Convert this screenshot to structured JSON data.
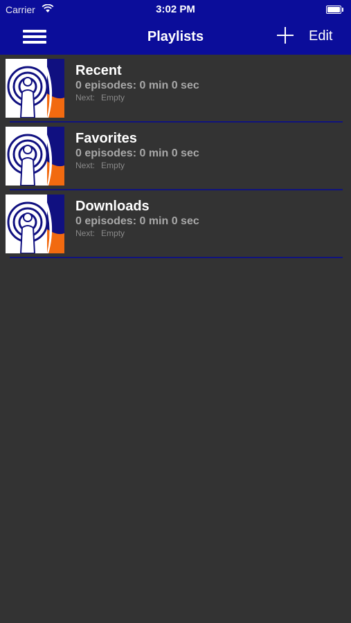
{
  "status_bar": {
    "carrier": "Carrier",
    "time": "3:02 PM"
  },
  "nav": {
    "title": "Playlists",
    "edit_label": "Edit"
  },
  "playlists": [
    {
      "title": "Recent",
      "summary": "0 episodes: 0 min 0 sec",
      "next_label": "Next:",
      "next_value": "Empty"
    },
    {
      "title": "Favorites",
      "summary": "0 episodes: 0 min 0 sec",
      "next_label": "Next:",
      "next_value": "Empty"
    },
    {
      "title": "Downloads",
      "summary": "0 episodes: 0 min 0 sec",
      "next_label": "Next:",
      "next_value": "Empty"
    }
  ],
  "colors": {
    "bar": "#0b0d9a",
    "background": "#333333",
    "divider": "#10137e",
    "accent_orange": "#f26a10"
  }
}
